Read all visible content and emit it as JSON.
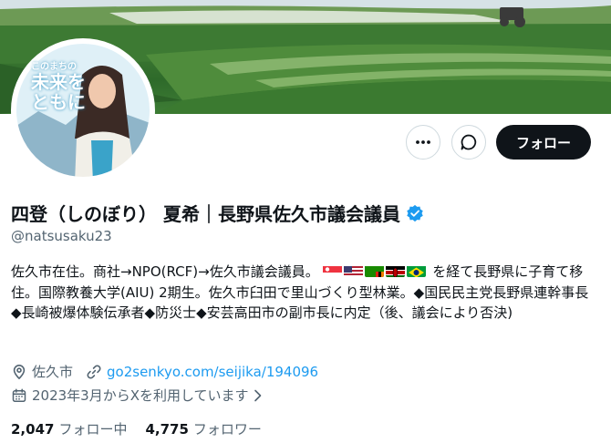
{
  "profile": {
    "avatar_text_line1": "このまちの",
    "avatar_text_line2": "未来を",
    "avatar_text_line3": "ともに",
    "display_name": "四登（しのぼり） 夏希｜長野県佐久市議会議員",
    "handle": "@natsusaku23",
    "bio_part1": "佐久市在住。商社→NPO(RCF)→佐久市議会議員。",
    "bio_part2": "を経て長野県に子育て移住。国際教養大学(AIU) 2期生。佐久市臼田で里山づくり型林業。◆国民民主党長野県連幹事長 ◆長崎被爆体験伝承者◆防災士◆安芸高田市の副市長に内定（後、議会により否決)",
    "location": "佐久市",
    "website": "go2senkyo.com/seijika/194096",
    "joined": "2023年3月からXを利用しています",
    "following_count": "2,047",
    "following_label": "フォロー中",
    "followers_count": "4,775",
    "followers_label": "フォロワー"
  },
  "actions": {
    "more_label": "more",
    "message_label": "message",
    "follow_label": "フォロー"
  },
  "flags": [
    "singapore-flag",
    "usa-flag",
    "zambia-flag",
    "kenya-flag",
    "brazil-flag"
  ],
  "colors": {
    "accent": "#1d9bf0",
    "follow_button": "#0f1419",
    "secondary_text": "#536471"
  }
}
